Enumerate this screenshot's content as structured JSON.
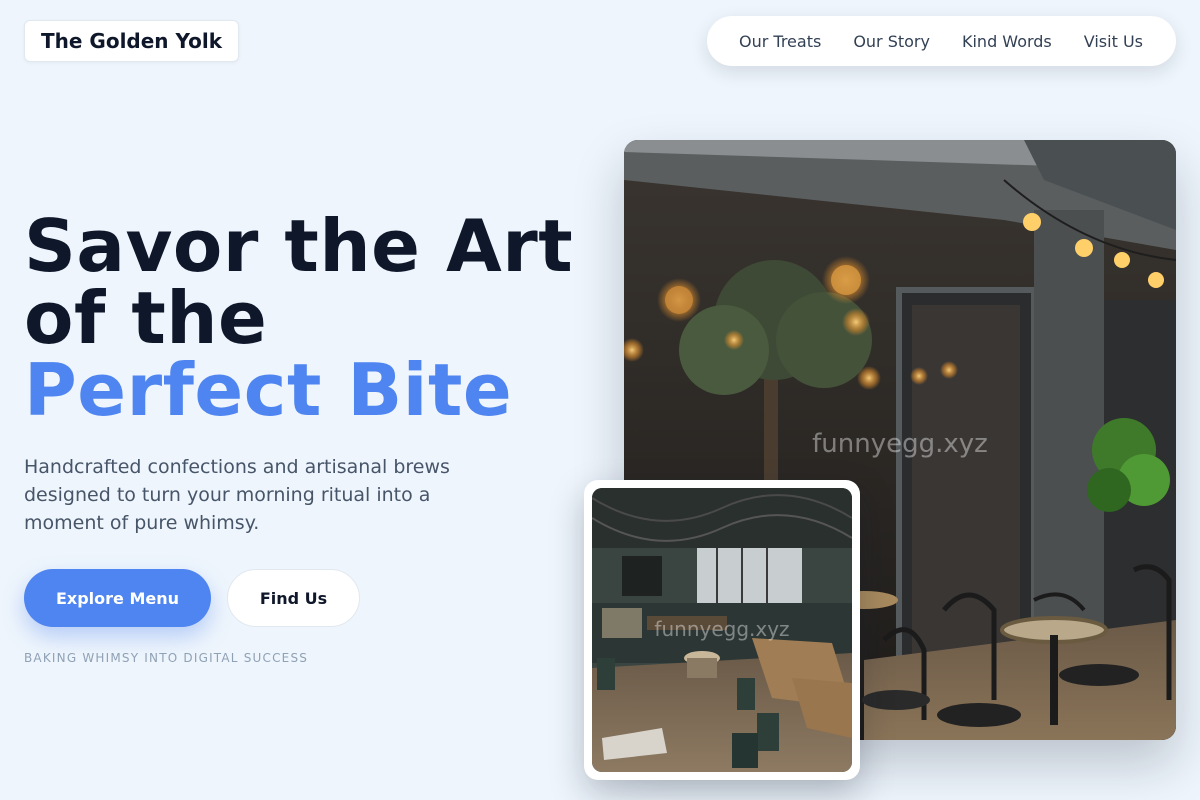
{
  "brand": {
    "name": "The Golden Yolk"
  },
  "nav": {
    "items": [
      {
        "label": "Our Treats"
      },
      {
        "label": "Our Story"
      },
      {
        "label": "Kind Words"
      },
      {
        "label": "Visit Us"
      }
    ]
  },
  "hero": {
    "headline_line1": "Savor the Art",
    "headline_line2": "of the",
    "headline_accent": "Perfect Bite",
    "subtitle": "Handcrafted confections and artisanal brews designed to turn your morning ritual into a moment of pure whimsy.",
    "primary_button": "Explore Menu",
    "secondary_button": "Find Us",
    "tagline": "BAKING WHIMSY INTO DIGITAL SUCCESS"
  },
  "images": {
    "main_alt": "Cafe terrace with hanging lights and bistro chairs",
    "small_alt": "Cafe interior with wooden tables and counter",
    "watermark": "funnyegg.xyz"
  },
  "colors": {
    "background": "#eef5fc",
    "accent": "#4f85f0",
    "heading": "#0f172a",
    "body_text": "#475569"
  }
}
